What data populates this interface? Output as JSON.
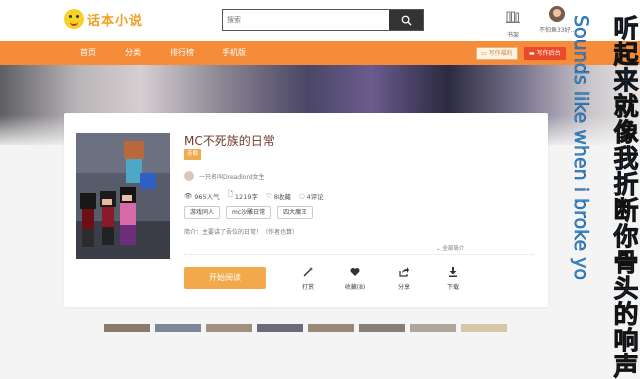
{
  "header": {
    "logo_text": "话本小说",
    "search_placeholder": "搜索",
    "bookshelf_label": "书架",
    "username": "不怕鱼33好..."
  },
  "nav": {
    "items": [
      "首页",
      "分类",
      "排行榜",
      "手机版"
    ],
    "write_benefit": "写作福利",
    "write_backend": "写作后台"
  },
  "book": {
    "title": "MC不死族的日常",
    "tag": "连载",
    "author": "一只名叫Dreadlord女生",
    "popularity": "965人气",
    "word_count": "1219字",
    "favorites": "8收藏",
    "comments": "4评论",
    "tags": [
      "游戏同人",
      "mc沙雕日常",
      "四大魔王"
    ],
    "intro": "简介：主要讲了吾位的日常！（作者也算）",
    "more_intro": "全部简介"
  },
  "actions": {
    "read": "开始阅读",
    "reward": "打赏",
    "favorite": "收藏(8)",
    "share": "分享",
    "download": "下载"
  },
  "overlay": {
    "chinese_lyric": "听起来就像我折断你骨头的响声",
    "english_lyric": "Sounds like when i broke yo"
  },
  "colors": {
    "nav_orange": "#f58c39",
    "title_brown": "#6d3a2a",
    "button_orange": "#f1a94c",
    "overlay_blue": "#1e74d6"
  }
}
